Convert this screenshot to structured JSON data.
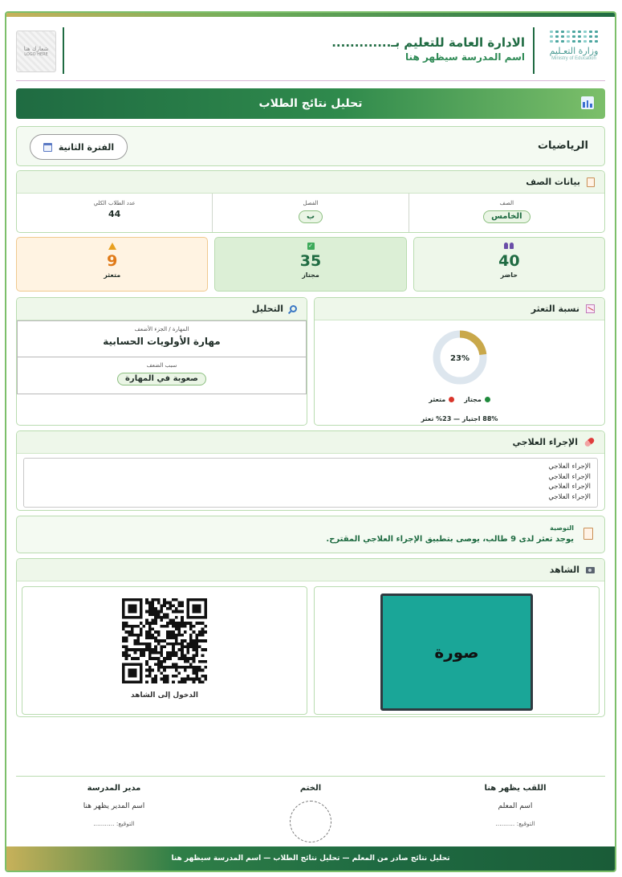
{
  "header": {
    "ministry_ar": "وزارة التعـليم",
    "ministry_en": "Ministry of Education",
    "admin_title": "الادارة العامة للتعليم بـ.............",
    "school_placeholder": "اسم المدرسة سيظهر هنا",
    "logo_text": "شعارك هنا",
    "logo_subtext": "LOGO HERE"
  },
  "banner": {
    "title": "تحليل نتائج الطلاب"
  },
  "subject": {
    "name": "الرياضيات",
    "period": "الفترة الثانية"
  },
  "class_data": {
    "title": "بيانات الصف",
    "cells": [
      {
        "label": "الصف",
        "value": "الخامس",
        "tagged": true
      },
      {
        "label": "الفصل",
        "value": "ب",
        "tagged": true
      },
      {
        "label": "عدد الطلاب الكلي",
        "value": "44",
        "tagged": false
      }
    ]
  },
  "stats": {
    "present": {
      "value": "40",
      "label": "حاضر"
    },
    "passed": {
      "value": "35",
      "label": "مجتاز"
    },
    "struggling": {
      "value": "9",
      "label": "متعثر"
    }
  },
  "rate": {
    "title": "نسبة التعثر",
    "legend_passed": "مجتاز",
    "legend_struggling": "متعثر",
    "summary": "88% اجتياز — 23% تعثر",
    "colors": {
      "struggling": "#c9a84a",
      "passed_track": "#dde6ee",
      "dot_passed": "#1f8a3c",
      "dot_struggling": "#d9352b"
    }
  },
  "chart_data": {
    "type": "pie",
    "categories": [
      "متعثر",
      "مجتاز"
    ],
    "values": [
      23,
      77
    ],
    "center_label": "23%"
  },
  "analysis": {
    "title": "التحليل",
    "skill_label": "المهارة / الجزء الأضعف",
    "skill_value": "مهارة الأولويات الحسابية",
    "reason_label": "سبب الضعف",
    "reason_value": "صعوبة في المهارة"
  },
  "remedial": {
    "title": "الإجراء العلاجي",
    "lines": [
      "الإجراء العلاجي",
      "الإجراء العلاجي",
      "الإجراء العلاجي",
      "الإجراء العلاجي"
    ]
  },
  "recommendation": {
    "label": "التوصية",
    "text": "يوجد تعثر لدى 9 طالب، يوصى بتطبيق الإجراء العلاجي المقترح."
  },
  "evidence": {
    "title": "الشاهد",
    "photo_text": "صورة",
    "qr_label": "الدخول إلى الشاهد"
  },
  "signatures": {
    "teacher_title": "اللقب يظهر هنا",
    "teacher_name": "اسم المعلم",
    "teacher_sign": "التوقيع: ..........",
    "seal_title": "الختم",
    "principal_title": "مدير المدرسة",
    "principal_name": "اسم المدير يظهر هنا",
    "principal_sign": "التوقيع: ..........."
  },
  "footer": {
    "text": "تحليل نتائج صادر من المعلم — تحليل نتائج الطلاب — اسم المدرسة سيظهر هنا"
  }
}
